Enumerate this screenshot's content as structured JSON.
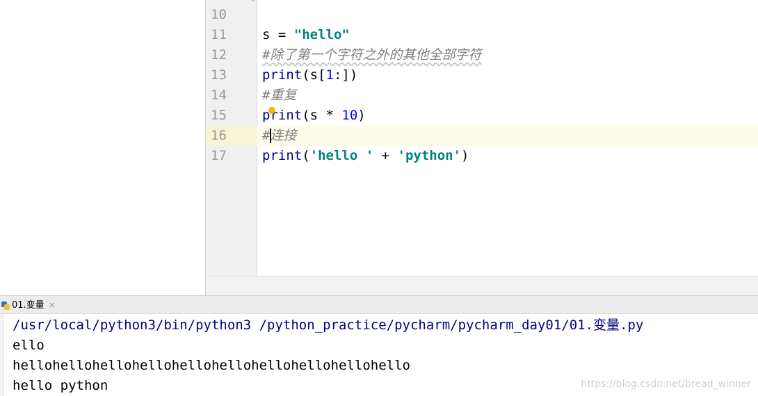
{
  "editor": {
    "lines": [
      {
        "num": "10"
      },
      {
        "num": "11",
        "t1": "s = ",
        "t2": "\"hello\""
      },
      {
        "num": "12",
        "t1": "#除了第一个字符之外的其他全部字符"
      },
      {
        "num": "13",
        "t1": "print",
        "t2": "(s[",
        "t3": "1",
        "t4": ":])"
      },
      {
        "num": "14",
        "t1": "#重复"
      },
      {
        "num": "15",
        "t1": "print",
        "t2": "(s * ",
        "t3": "10",
        "t4": ")"
      },
      {
        "num": "16",
        "t1": "#连接"
      },
      {
        "num": "17",
        "t1": "print",
        "t2": "(",
        "t3": "'hello '",
        "t4": " + ",
        "t5": "'python'",
        "t6": ")"
      }
    ]
  },
  "run": {
    "tab_label": "01.变量",
    "close_glyph": "×",
    "output": [
      "/usr/local/python3/bin/python3 /python_practice/pycharm/pycharm_day01/01.变量.py",
      "ello",
      "hellohellohellohellohellohellohellohellohellohello",
      "hello python"
    ]
  },
  "watermark": "https://blog.csdn.net/bread_winner",
  "colors": {
    "keyword": "#000080",
    "number": "#0000ff",
    "string": "#008080",
    "comment": "#808080",
    "current_line": "#fcfae8"
  },
  "icons": {
    "run_tab": "python-file-icon",
    "intention": "lightbulb-icon"
  }
}
